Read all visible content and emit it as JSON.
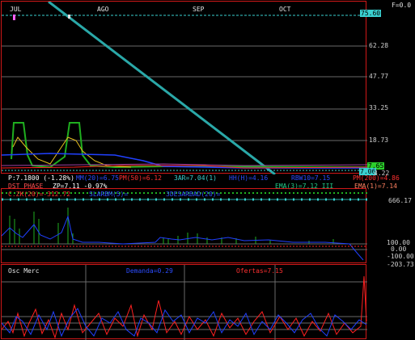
{
  "header": {
    "f_value": "F=0.0"
  },
  "months": [
    "JUL",
    "AGO",
    "SEP",
    "OCT"
  ],
  "price_scale": [
    "75.60",
    "62.28",
    "47.77",
    "33.25",
    "18.73",
    "4.22"
  ],
  "price_tags": {
    "top": "75.60",
    "last1": "7.65",
    "last2": "7.06"
  },
  "indicators": {
    "row1": [
      {
        "text": "P:7.1800 (-1.28%)",
        "color": "#ffffff"
      },
      {
        "text": "MM(20)=6.75",
        "color": "#2c4cff"
      },
      {
        "text": "PM(50)=6.12",
        "color": "#ff3030"
      },
      {
        "text": "3AR=7.04(1)",
        "color": "#3ad0d0"
      },
      {
        "text": "HH(H)=4.16",
        "color": "#2c4cff"
      },
      {
        "text": "RBW10=7.15",
        "color": "#2c4cff"
      },
      {
        "text": "PM(200)=4.86",
        "color": "#ff3030"
      }
    ],
    "row2": [
      {
        "text": "DST PHASE",
        "color": "#ff5050"
      },
      {
        "text": "ZP=7.11  -0.97%",
        "color": "#ffffff"
      },
      {
        "text": "EMA(3)=7.12 III",
        "color": "#22cc88"
      },
      {
        "text": "EMA(1)=7.14",
        "color": "#ff8060"
      }
    ],
    "row3": [
      {
        "text": "C.ZK(20)=-312.72",
        "color": "#ff3030"
      },
      {
        "text": "SLARBM(5)=",
        "color": "#3050ff"
      },
      {
        "text": "3DESARBAD(20)=",
        "color": "#3050ff"
      }
    ]
  },
  "cci_scale": [
    "666.17",
    "100.00",
    "0.00",
    "-100.00",
    "-203.73"
  ],
  "osc": {
    "title": "Osc Merc",
    "demanda": "Demanda=0.29",
    "ofertas": "Ofertas=7.15"
  },
  "colors": {
    "frame": "#d01818",
    "teal": "#2aa8a8",
    "green": "#1fae1f",
    "blue": "#2040ff",
    "red": "#ff2020"
  }
}
